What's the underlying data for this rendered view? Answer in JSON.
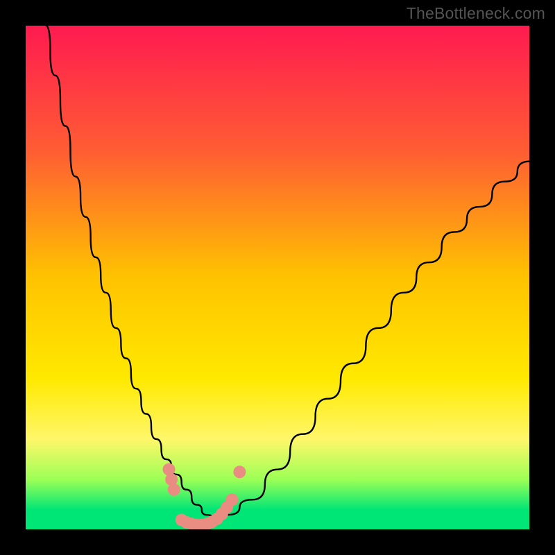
{
  "watermark": "TheBottleneck.com",
  "chart_data": {
    "type": "line",
    "title": "",
    "xlabel": "",
    "ylabel": "",
    "xlim": [
      0,
      100
    ],
    "ylim": [
      0,
      100
    ],
    "background_gradient": {
      "stops": [
        {
          "y": 0,
          "color": "#ff1a50"
        },
        {
          "y": 25,
          "color": "#ff5d33"
        },
        {
          "y": 50,
          "color": "#ffc300"
        },
        {
          "y": 70,
          "color": "#ffe900"
        },
        {
          "y": 82,
          "color": "#fff76a"
        },
        {
          "y": 90,
          "color": "#9cff55"
        },
        {
          "y": 96,
          "color": "#00e676"
        },
        {
          "y": 100,
          "color": "#00e676"
        }
      ]
    },
    "series": [
      {
        "name": "bottleneck-curve",
        "x": [
          4,
          6,
          8,
          10,
          12,
          14,
          16,
          18,
          20,
          22,
          24,
          26,
          28,
          30,
          32,
          34,
          36,
          38,
          40,
          45,
          50,
          55,
          60,
          65,
          70,
          75,
          80,
          85,
          90,
          95,
          100
        ],
        "y": [
          100,
          90,
          80,
          70,
          62,
          54,
          47,
          40,
          34,
          28,
          23,
          18,
          14,
          11,
          8,
          5,
          3,
          2,
          3,
          6,
          12,
          19,
          26,
          33,
          40,
          47,
          53,
          59,
          64,
          69,
          73
        ]
      }
    ],
    "markers": {
      "name": "highlight-dots",
      "color": "#e98d82",
      "points": [
        {
          "x": 28.5,
          "y": 12
        },
        {
          "x": 29.0,
          "y": 10
        },
        {
          "x": 29.5,
          "y": 8
        },
        {
          "x": 31.0,
          "y": 2
        },
        {
          "x": 32.0,
          "y": 1.5
        },
        {
          "x": 33.0,
          "y": 1.2
        },
        {
          "x": 34.0,
          "y": 1.0
        },
        {
          "x": 35.0,
          "y": 1.0
        },
        {
          "x": 36.0,
          "y": 1.2
        },
        {
          "x": 37.0,
          "y": 1.6
        },
        {
          "x": 38.0,
          "y": 2.2
        },
        {
          "x": 39.0,
          "y": 3.2
        },
        {
          "x": 40.0,
          "y": 4.5
        },
        {
          "x": 41.0,
          "y": 6.0
        },
        {
          "x": 42.5,
          "y": 11.5
        }
      ]
    },
    "frame": {
      "outer_color": "#000000",
      "inner_margin_pct": 4.5
    }
  }
}
